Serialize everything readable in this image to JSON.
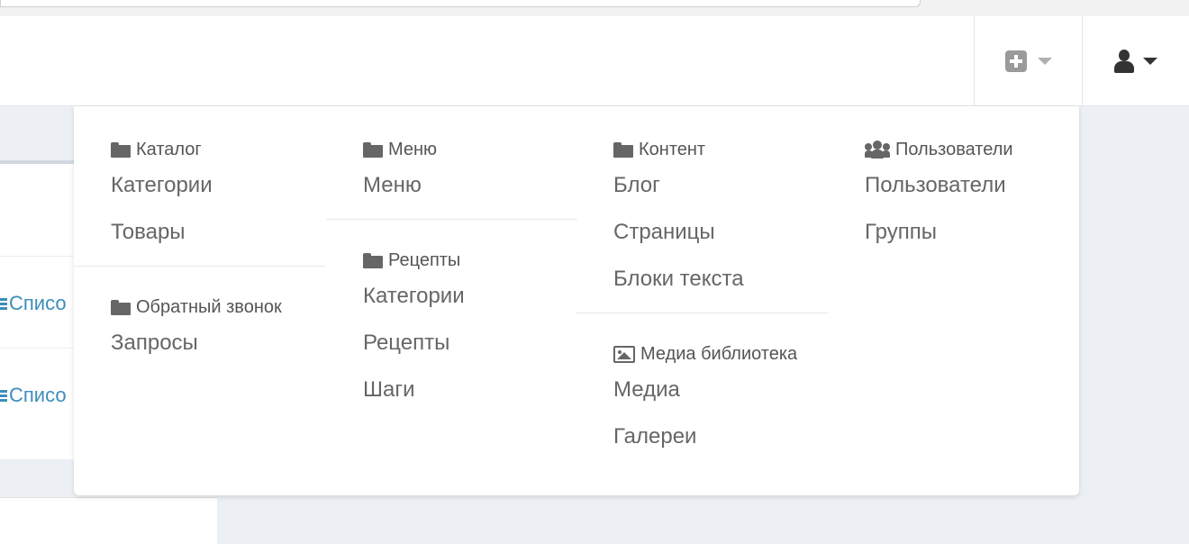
{
  "colors": {
    "link": "#3c8dbc",
    "menu_text": "#666666",
    "background": "#ecf0f5"
  },
  "navbar": {
    "add_button_icon": "plus-square-icon",
    "user_button_icon": "user-icon"
  },
  "background_content": {
    "rows": [
      {
        "label": "Списо"
      },
      {
        "label": "Списо"
      }
    ]
  },
  "dropdown": {
    "catalog": {
      "header": "Каталог",
      "icon": "folder-icon",
      "items": [
        "Категории",
        "Товары"
      ]
    },
    "callback": {
      "header": "Обратный звонок",
      "icon": "folder-icon",
      "items": [
        "Запросы"
      ]
    },
    "menu": {
      "header": "Меню",
      "icon": "folder-icon",
      "items": [
        "Меню"
      ]
    },
    "recipes": {
      "header": "Рецепты",
      "icon": "folder-icon",
      "items": [
        "Категории",
        "Рецепты",
        "Шаги"
      ]
    },
    "content": {
      "header": "Контент",
      "icon": "folder-icon",
      "items": [
        "Блог",
        "Страницы",
        "Блоки текста"
      ]
    },
    "media": {
      "header": "Медиа библиотека",
      "icon": "image-icon",
      "items": [
        "Медиа",
        "Галереи"
      ]
    },
    "users": {
      "header": "Пользователи",
      "icon": "users-icon",
      "items": [
        "Пользователи",
        "Группы"
      ]
    }
  }
}
